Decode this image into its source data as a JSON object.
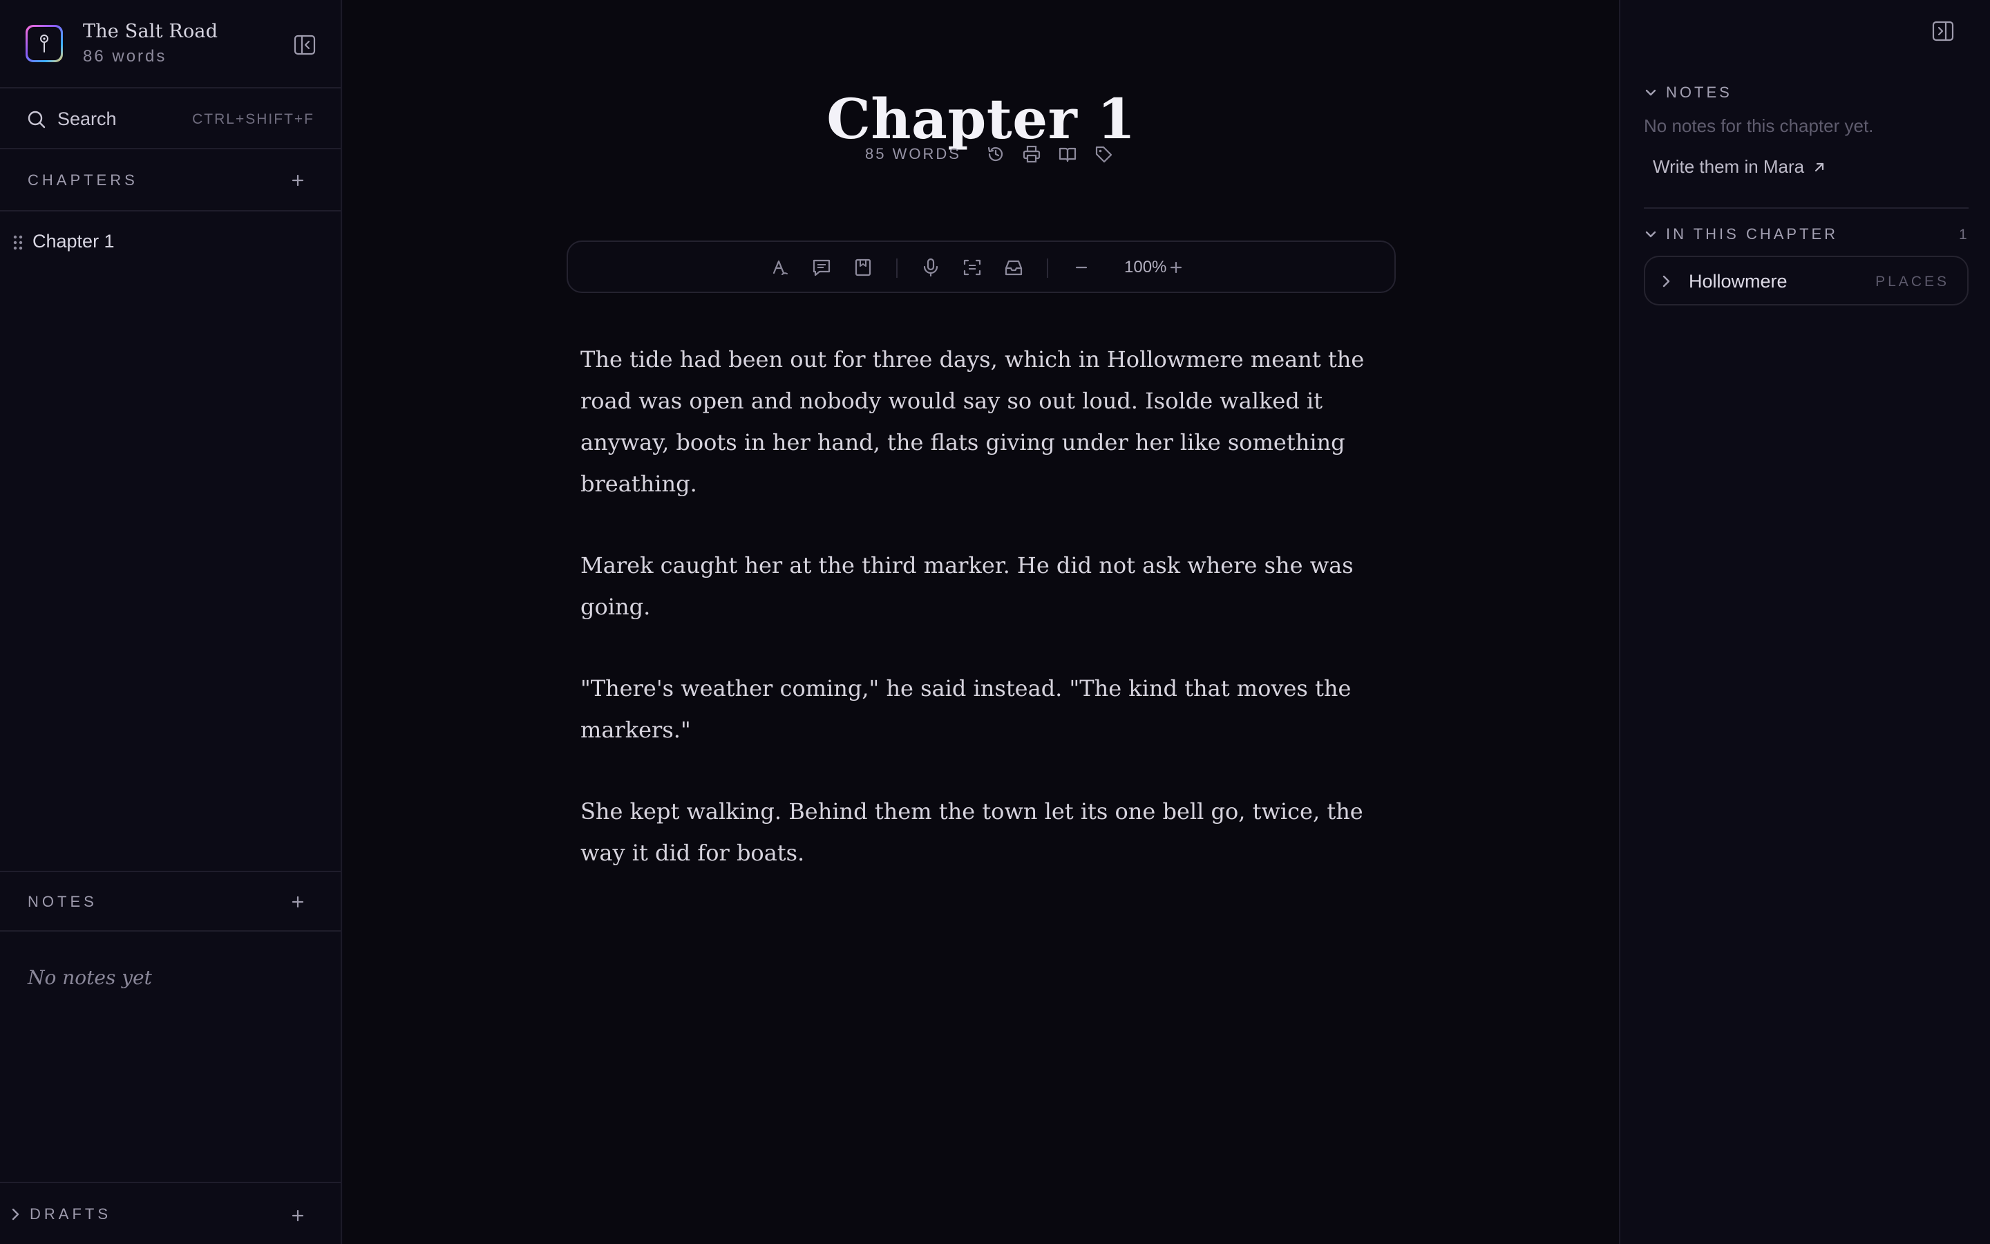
{
  "project": {
    "title": "The Salt Road",
    "word_count": "86 words"
  },
  "search": {
    "label": "Search",
    "shortcut": "CTRL+SHIFT+F"
  },
  "sidebar": {
    "chapters_label": "CHAPTERS",
    "chapters": [
      {
        "label": "Chapter 1"
      }
    ],
    "notes_label": "NOTES",
    "notes_empty": "No notes yet",
    "drafts_label": "DRAFTS"
  },
  "editor": {
    "chapter_title": "Chapter 1",
    "word_count": "85 WORDS",
    "zoom": "100%",
    "paragraphs": [
      "The tide had been out for three days, which in Hollowmere meant the road was open and nobody would say so out loud. Isolde walked it anyway, boots in her hand, the flats giving under her like something breathing.",
      "Marek caught her at the third marker. He did not ask where she was going.",
      "\"There's weather coming,\" he said instead. \"The kind that moves the markers.\"",
      "She kept walking. Behind them the town let its one bell go, twice, the way it did for boats."
    ]
  },
  "right_panel": {
    "notes_label": "NOTES",
    "notes_empty": "No notes for this chapter yet.",
    "notes_link": "Write them in Mara",
    "in_chapter_label": "IN THIS CHAPTER",
    "in_chapter_count": "1",
    "entities": [
      {
        "name": "Hollowmere",
        "type": "PLACES"
      }
    ]
  },
  "colors": {
    "background": "#09080f",
    "sidebar": "#0c0b16",
    "text": "#d7d4de",
    "muted": "#9e9bad"
  }
}
